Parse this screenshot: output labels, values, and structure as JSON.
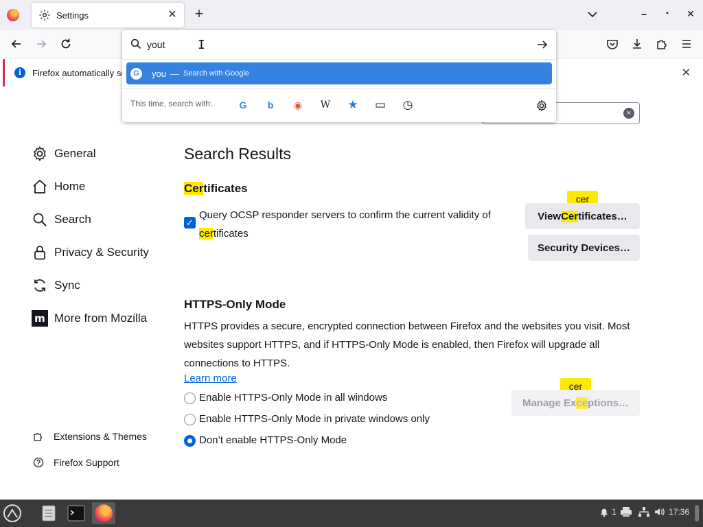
{
  "tab": {
    "title": "Settings",
    "close": "✕"
  },
  "newtab": "+",
  "window": {
    "minimize": "–",
    "maximize": "▪",
    "close": "✕"
  },
  "notification": {
    "text": "Firefox automatically se",
    "info_glyph": "i",
    "close": "✕"
  },
  "urlbar": {
    "value": "yout",
    "suggestion": {
      "text": "you",
      "separator": "—",
      "action": "Search with Google",
      "badge": "G"
    },
    "oneoff_label": "This time, search with:",
    "engines": [
      {
        "name": "Google",
        "glyph": "G",
        "color": "#4285f4"
      },
      {
        "name": "Bing",
        "glyph": "b",
        "color": "#2a7ad5"
      },
      {
        "name": "DuckDuckGo",
        "glyph": "◉",
        "color": "#de5833"
      },
      {
        "name": "Wikipedia",
        "glyph": "W",
        "color": "#222222"
      },
      {
        "name": "Bookmarks",
        "glyph": "★",
        "color": "#2a7ad5"
      },
      {
        "name": "Tabs",
        "glyph": "▭",
        "color": "#222222"
      },
      {
        "name": "History",
        "glyph": "◷",
        "color": "#222222"
      }
    ]
  },
  "prefsearch": {
    "clear": "×"
  },
  "sidebar": {
    "categories": [
      {
        "label": "General",
        "icon": "gear-icon"
      },
      {
        "label": "Home",
        "icon": "home-icon"
      },
      {
        "label": "Search",
        "icon": "search-icon"
      },
      {
        "label": "Privacy & Security",
        "icon": "lock-icon"
      },
      {
        "label": "Sync",
        "icon": "sync-icon"
      },
      {
        "label": "More from Mozilla",
        "icon": "mozilla-icon"
      }
    ],
    "footer": [
      {
        "label": "Extensions & Themes",
        "icon": "puzzle-icon"
      },
      {
        "label": "Firefox Support",
        "icon": "help-icon"
      }
    ]
  },
  "main": {
    "title": "Search Results",
    "certificates": {
      "heading_hl": "Cer",
      "heading_rest": "tificates",
      "checkbox_checked": true,
      "checkbox_glyph": "✓",
      "label_part1": "Query OCSP responder servers to confirm the current validity of ",
      "label_hl": "cer",
      "label_part2": "tificates",
      "view_btn_pre": "View ",
      "view_btn_hl": "Cer",
      "view_btn_post": "tificates…",
      "devices_btn": "Security Devices…",
      "bubble": "cer"
    },
    "https": {
      "heading": "HTTPS-Only Mode",
      "description": "HTTPS provides a secure, encrypted connection between Firefox and the websites you visit. Most websites support HTTPS, and if HTTPS-Only Mode is enabled, then Firefox will upgrade all connections to HTTPS.",
      "learn_more": "Learn more",
      "options": [
        {
          "label": "Enable HTTPS-Only Mode in all windows",
          "selected": false
        },
        {
          "label": "Enable HTTPS-Only Mode in private windows only",
          "selected": false
        },
        {
          "label": "Don’t enable HTTPS-Only Mode",
          "selected": true
        }
      ],
      "exceptions_btn_pre": "Manage Ex",
      "exceptions_btn_hl": "ce",
      "exceptions_btn_post": "ptions…",
      "bubble": "cer"
    }
  },
  "taskbar": {
    "notif_count": "1",
    "clock": "17:36"
  },
  "colors": {
    "accent": "#0061e0",
    "highlight": "#ffe900",
    "suggestion_bg": "#3581df",
    "taskbar": "#3a3a3a"
  }
}
